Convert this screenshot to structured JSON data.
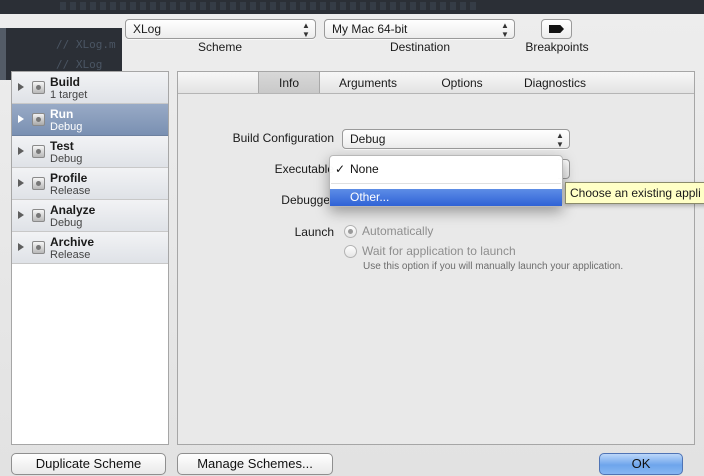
{
  "background_editor": {
    "code_lines": [
      "//    XLog.m",
      "//    XLog"
    ]
  },
  "toolbar": {
    "scheme_value": "XLog",
    "scheme_label": "Scheme",
    "destination_value": "My Mac 64-bit",
    "destination_label": "Destination",
    "breakpoints_label": "Breakpoints"
  },
  "sidebar": {
    "items": [
      {
        "title": "Build",
        "subtitle": "1 target",
        "selected": false
      },
      {
        "title": "Run",
        "subtitle": "Debug",
        "selected": true
      },
      {
        "title": "Test",
        "subtitle": "Debug",
        "selected": false
      },
      {
        "title": "Profile",
        "subtitle": "Release",
        "selected": false
      },
      {
        "title": "Analyze",
        "subtitle": "Debug",
        "selected": false
      },
      {
        "title": "Archive",
        "subtitle": "Release",
        "selected": false
      }
    ]
  },
  "tabs": [
    {
      "label": "Info",
      "active": true
    },
    {
      "label": "Arguments",
      "active": false
    },
    {
      "label": "Options",
      "active": false
    },
    {
      "label": "Diagnostics",
      "active": false
    }
  ],
  "form": {
    "build_configuration_label": "Build Configuration",
    "build_configuration_value": "Debug",
    "executable_label": "Executable",
    "debugger_label": "Debugger",
    "launch_label": "Launch",
    "launch_options": [
      {
        "label": "Automatically",
        "checked": true
      },
      {
        "label": "Wait for application to launch",
        "checked": false
      }
    ],
    "launch_hint": "Use this option if you will manually launch your application."
  },
  "executable_menu": {
    "items": [
      {
        "label": "None",
        "checked": true,
        "highlighted": false
      },
      {
        "label": "Other...",
        "checked": false,
        "highlighted": true
      }
    ],
    "check_glyph": "✓"
  },
  "tooltip": {
    "text": "Choose an existing appli"
  },
  "buttons": {
    "duplicate": "Duplicate Scheme",
    "manage": "Manage Schemes...",
    "ok": "OK"
  },
  "colors": {
    "selection": "#7a90b2",
    "menu_highlight": "#2f62d6",
    "ok_button": "#6ea5ec",
    "tooltip_bg": "#ffffc6"
  }
}
